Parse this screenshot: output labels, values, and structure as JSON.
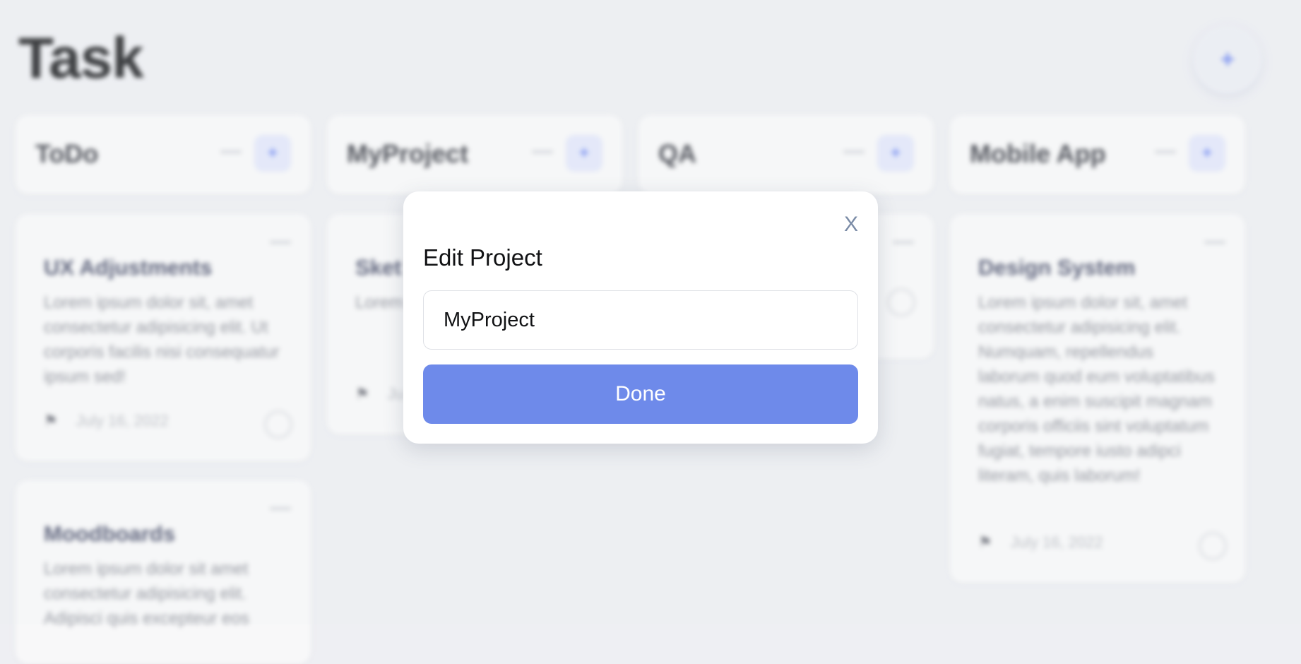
{
  "page": {
    "title": "Task",
    "add_icon": "+"
  },
  "columns": [
    {
      "name": "ToDo",
      "more_icon": "more-icon",
      "add_icon": "+"
    },
    {
      "name": "MyProject",
      "more_icon": "more-icon",
      "add_icon": "+"
    },
    {
      "name": "QA",
      "more_icon": "more-icon",
      "add_icon": "+"
    },
    {
      "name": "Mobile App",
      "more_icon": "more-icon",
      "add_icon": "+"
    }
  ],
  "cards": [
    {
      "title": "UX Adjustments",
      "description": "Lorem ipsum dolor sit, amet consectetur adipisicing elit. Ut corporis facilis nisi consequatur ipsum sed!",
      "date": "July 16, 2022"
    },
    {
      "title": "Moodboards",
      "description": "Lorem ipsum dolor sit amet consectetur adipisicing elit. Adipisci quis excepteur eos"
    },
    {
      "title": "Sket",
      "description": "Lorem conse fuga",
      "date": "Ju"
    },
    {
      "title": "Design System",
      "description": "Lorem ipsum dolor sit, amet consectetur adipisicing elit. Numquam, repellendus laborum quod eum voluptatibus natus, a enim suscipit magnam corporis officiis sint voluptatum fugiat, tempore iusto adipci literam, quis laborum!",
      "date": "July 16, 2022"
    }
  ],
  "modal": {
    "title": "Edit Project",
    "close_label": "X",
    "input_value": "MyProject",
    "done_label": "Done"
  },
  "colors": {
    "accent": "#6e8aea",
    "background": "#eeeff3"
  }
}
